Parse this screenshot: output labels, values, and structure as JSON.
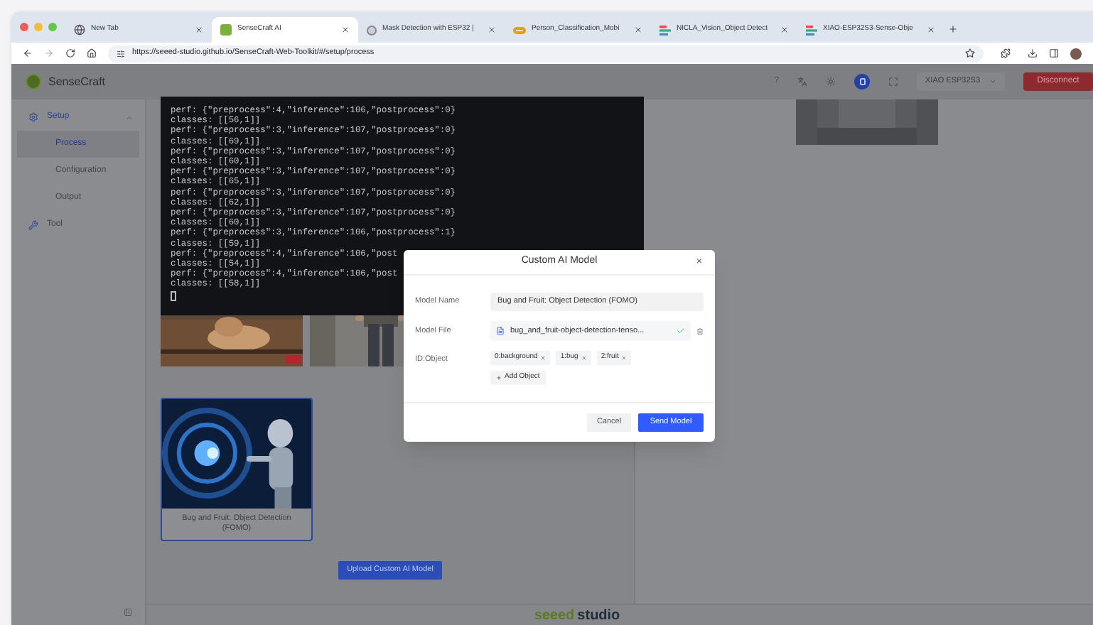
{
  "browser": {
    "tabs": [
      {
        "title": "New Tab",
        "selected": false
      },
      {
        "title": "SenseCraft AI",
        "selected": true
      },
      {
        "title": "Mask Detection with ESP32 |",
        "selected": false
      },
      {
        "title": "Person_Classification_Mobi",
        "selected": false
      },
      {
        "title": "NICLA_Vision_Object Detect",
        "selected": false
      },
      {
        "title": "XIAO-ESP32S3-Sense-Obje",
        "selected": false
      }
    ],
    "address": "https://seeed-studio.github.io/SenseCraft-Web-Toolkit/#/setup/process"
  },
  "header": {
    "brand": "SenseCraft",
    "help": "?",
    "device": "XIAO ESP32S3",
    "disconnect": "Disconnect"
  },
  "sidebar": {
    "items": [
      {
        "label": "Setup",
        "expanded": true,
        "children": [
          {
            "label": "Process",
            "selected": true
          },
          {
            "label": "Configuration",
            "selected": false
          },
          {
            "label": "Output",
            "selected": false
          }
        ]
      },
      {
        "label": "Tool"
      }
    ]
  },
  "terminal": {
    "lines": [
      "perf: {\"preprocess\":4,\"inference\":106,\"postprocess\":0}",
      "classes: [[56,1]]",
      "perf: {\"preprocess\":3,\"inference\":107,\"postprocess\":0}",
      "classes: [[69,1]]",
      "perf: {\"preprocess\":3,\"inference\":107,\"postprocess\":0}",
      "classes: [[60,1]]",
      "perf: {\"preprocess\":3,\"inference\":107,\"postprocess\":0}",
      "classes: [[65,1]]",
      "perf: {\"preprocess\":3,\"inference\":107,\"postprocess\":0}",
      "classes: [[62,1]]",
      "perf: {\"preprocess\":3,\"inference\":107,\"postprocess\":0}",
      "classes: [[60,1]]",
      "perf: {\"preprocess\":3,\"inference\":106,\"postprocess\":1}",
      "classes: [[59,1]]",
      "perf: {\"preprocess\":4,\"inference\":106,\"post",
      "classes: [[54,1]]",
      "perf: {\"preprocess\":4,\"inference\":106,\"post",
      "classes: [[58,1]]"
    ]
  },
  "models": [
    {
      "kind": "picture",
      "selected": false
    },
    {
      "kind": "picture",
      "selected": false
    },
    {
      "kind": "picture",
      "selected": true,
      "caption": "Bug and Fruit: Object Detection (FOMO)"
    }
  ],
  "upload_button": "Upload Custom AI Model",
  "modal": {
    "title": "Custom AI Model",
    "close": "×",
    "model_name_label": "Model Name",
    "model_name": "Bug and Fruit: Object Detection (FOMO)",
    "model_file_label": "Model File",
    "model_file": "bug_and_fruit-object-detection-tenso...",
    "file_verified": true,
    "id_object_label": "ID:Object",
    "objects": [
      "0:background",
      "1:bug",
      "2:fruit"
    ],
    "add_object": "Add Object",
    "cancel": "Cancel",
    "submit": "Send Model"
  },
  "footer": {
    "brand": "seeed",
    "brand_suffix": "studio"
  }
}
